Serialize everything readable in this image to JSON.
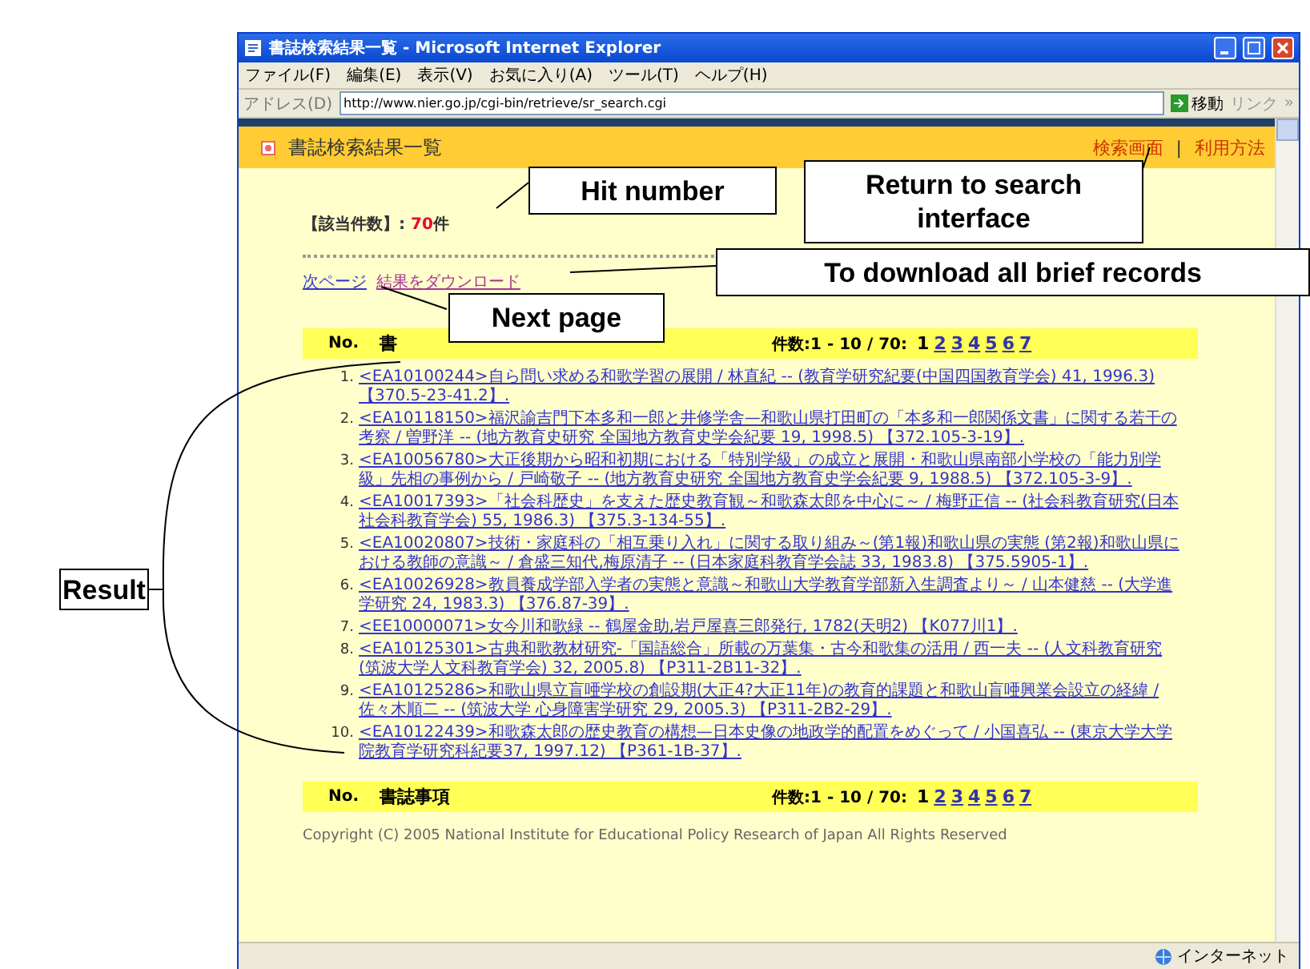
{
  "window": {
    "title": "書誌検索結果一覧 - Microsoft Internet Explorer"
  },
  "menu": [
    "ファイル(F)",
    "編集(E)",
    "表示(V)",
    "お気に入り(A)",
    "ツール(T)",
    "ヘルプ(H)"
  ],
  "address_bar": {
    "label": "アドレス(D)",
    "url": "http://www.nier.go.jp/cgi-bin/retrieve/sr_search.cgi",
    "go": "移動",
    "links": "リンク",
    "more": "»"
  },
  "page": {
    "title": "書誌検索結果一覧",
    "header_links": [
      "検索画面",
      "利用方法"
    ],
    "header_separator": "|",
    "hit_label": "【該当件数】: ",
    "hit_count": "70",
    "hit_unit": "件",
    "nav_links": [
      {
        "label": "次ページ",
        "visited": false
      },
      {
        "label": "結果をダウンロード",
        "visited": true
      }
    ],
    "table_header_top": {
      "no": "No.",
      "title": "書",
      "range": "件数:1 - 10 / 70:",
      "pages": [
        {
          "label": "1",
          "selected": true
        },
        {
          "label": "2",
          "selected": false
        },
        {
          "label": "3",
          "selected": false
        },
        {
          "label": "4",
          "selected": false
        },
        {
          "label": "5",
          "selected": false
        },
        {
          "label": "6",
          "selected": false
        },
        {
          "label": "7",
          "selected": false
        }
      ]
    },
    "records": [
      {
        "no": "1.",
        "text": "<EA10100244>自ら問い求める和歌学習の展開 / 林直紀 -- (教育学研究紀要(中国四国教育学会) 41, 1996.3) 【370.5-23-41.2】."
      },
      {
        "no": "2.",
        "text": "<EA10118150>福沢諭吉門下本多和一郎と井修学舎—和歌山県打田町の「本多和一郎関係文書」に関する若干の考察 / 曽野洋 -- (地方教育史研究 全国地方教育史学会紀要 19, 1998.5) 【372.105-3-19】."
      },
      {
        "no": "3.",
        "text": "<EA10056780>大正後期から昭和初期における「特別学級」の成立と展開・和歌山県南部小学校の「能力別学級」先相の事例から / 戸崎敬子 -- (地方教育史研究 全国地方教育史学会紀要 9, 1988.5) 【372.105-3-9】."
      },
      {
        "no": "4.",
        "text": "<EA10017393>「社会科歴史」を支えた歴史教育観～和歌森太郎を中心に～ / 梅野正信 -- (社会科教育研究(日本社会科教育学会) 55, 1986.3) 【375.3-134-55】."
      },
      {
        "no": "5.",
        "text": "<EA10020807>技術・家庭科の「相互乗り入れ」に関する取り組み～(第1報)和歌山県の実態 (第2報)和歌山県における教師の意識～ / 倉盛三知代,梅原清子 -- (日本家庭科教育学会誌 33, 1983.8) 【375.5905-1】."
      },
      {
        "no": "6.",
        "text": "<EA10026928>教員養成学部入学者の実態と意識～和歌山大学教育学部新入生調査より～ / 山本健慈 -- (大学進学研究 24, 1983.3) 【376.87-39】."
      },
      {
        "no": "7.",
        "text": "<EE10000071>女今川和歌緑 -- 鶴屋金助,岩戸屋喜三郎発行, 1782(天明2) 【K077川1】."
      },
      {
        "no": "8.",
        "text": "<EA10125301>古典和歌教材研究-「国語総合」所載の万葉集・古今和歌集の活用 / 西一夫 -- (人文科教育研究(筑波大学人文科教育学会) 32, 2005.8) 【P311-2B11-32】."
      },
      {
        "no": "9.",
        "text": "<EA10125286>和歌山県立盲唖学校の創設期(大正4?大正11年)の教育的課題と和歌山盲唖興業会設立の経緯 / 佐々木順二 -- (筑波大学 心身障害学研究 29, 2005.3) 【P311-2B2-29】."
      },
      {
        "no": "10.",
        "text": "<EA10122439>和歌森太郎の歴史教育の構想—日本史像の地政学的配置をめぐって / 小国喜弘 -- (東京大学大学院教育学研究科紀要37, 1997.12) 【P361-1B-37】."
      }
    ],
    "table_header_bottom": {
      "no": "No.",
      "title": "書誌事項",
      "range": "件数:1 - 10 / 70:",
      "pages": [
        {
          "label": "1",
          "selected": true
        },
        {
          "label": "2",
          "selected": false
        },
        {
          "label": "3",
          "selected": false
        },
        {
          "label": "4",
          "selected": false
        },
        {
          "label": "5",
          "selected": false
        },
        {
          "label": "6",
          "selected": false
        },
        {
          "label": "7",
          "selected": false
        }
      ]
    },
    "copyright": "Copyright (C) 2005 National Institute for Educational Policy Research of Japan All Rights Reserved"
  },
  "status_bar": {
    "zone": "インターネット"
  },
  "callouts": [
    "Hit number",
    "Return to search interface",
    "To download all brief records",
    "Next page",
    "Result"
  ]
}
